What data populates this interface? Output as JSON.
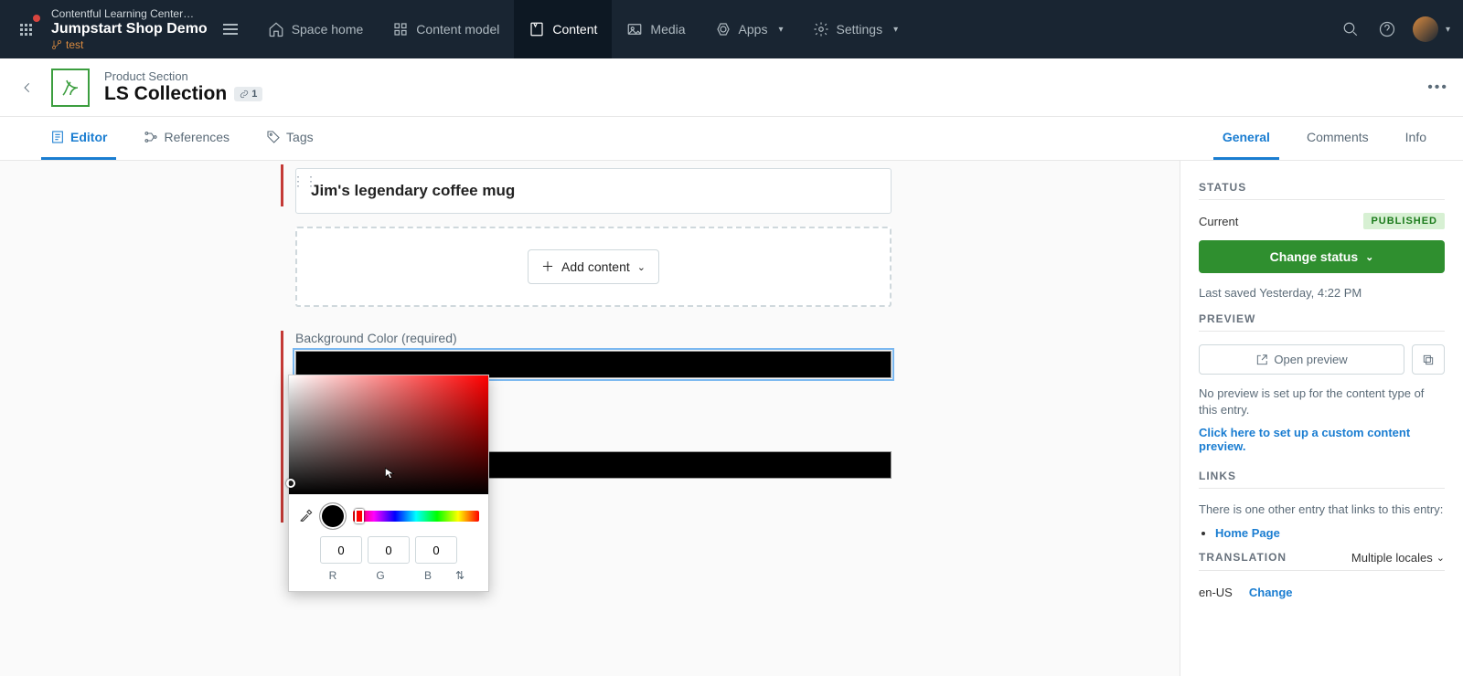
{
  "nav": {
    "org": "Contentful Learning Center…",
    "space": "Jumpstart Shop Demo",
    "env": "test",
    "items": [
      {
        "label": "Space home"
      },
      {
        "label": "Content model"
      },
      {
        "label": "Content"
      },
      {
        "label": "Media"
      },
      {
        "label": "Apps",
        "dropdown": true
      },
      {
        "label": "Settings",
        "dropdown": true
      }
    ]
  },
  "crumb": {
    "content_type": "Product Section",
    "title": "LS Collection",
    "link_count": "1"
  },
  "tabs_left": [
    {
      "label": "Editor"
    },
    {
      "label": "References"
    },
    {
      "label": "Tags"
    }
  ],
  "tabs_right": [
    {
      "label": "General"
    },
    {
      "label": "Comments"
    },
    {
      "label": "Info"
    }
  ],
  "main": {
    "ref_title": "Jim's legendary coffee mug",
    "add_content": "Add content",
    "bg_label": "Background Color (required)",
    "picker": {
      "r": "0",
      "g": "0",
      "b": "0"
    }
  },
  "side": {
    "status_h": "STATUS",
    "current_label": "Current",
    "status_badge": "PUBLISHED",
    "change_status": "Change status",
    "last_saved": "Last saved Yesterday, 4:22 PM",
    "preview_h": "PREVIEW",
    "open_preview": "Open preview",
    "no_preview": "No preview is set up for the content type of this entry.",
    "preview_link": "Click here to set up a custom content preview.",
    "links_h": "LINKS",
    "links_text": "There is one other entry that links to this entry:",
    "link_entry": "Home Page",
    "translation_h": "TRANSLATION",
    "multi_locales": "Multiple locales",
    "locale": "en-US",
    "change": "Change"
  }
}
